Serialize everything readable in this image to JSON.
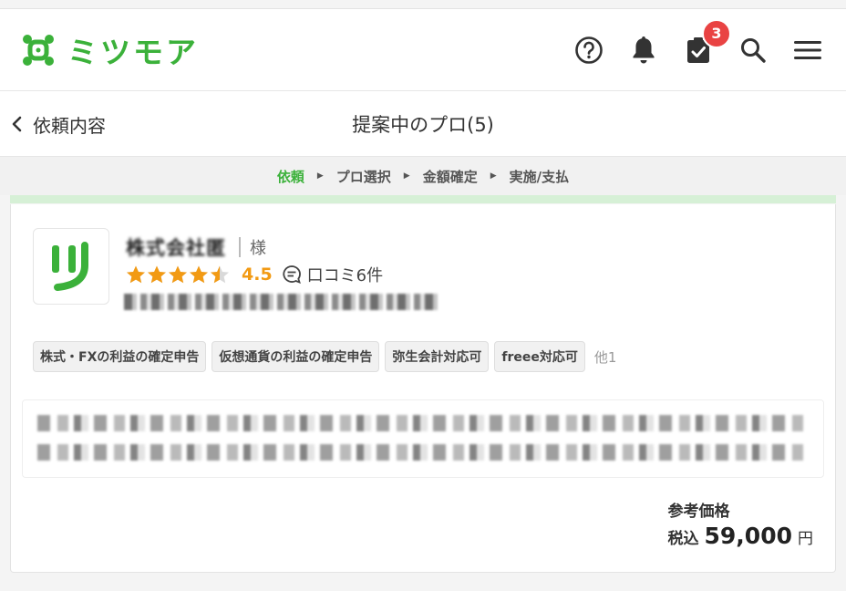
{
  "header": {
    "logo_text": "ミツモア",
    "icons": [
      "help-icon",
      "bell-icon",
      "task-check-icon",
      "search-icon",
      "menu-icon"
    ],
    "task_badge": "3",
    "colors": {
      "brand": "#3bb13a",
      "badge": "#e94343"
    }
  },
  "titlebar": {
    "back_label": "依頼内容",
    "title": "提案中のプロ(5)"
  },
  "steps": [
    {
      "label": "依頼",
      "active": true
    },
    {
      "label": "プロ選択",
      "active": false
    },
    {
      "label": "金額確定",
      "active": false
    },
    {
      "label": "実施/支払",
      "active": false
    }
  ],
  "pro": {
    "name": "株式会社匿",
    "honorific": "様",
    "rating": "4.5",
    "rating_value": 4.5,
    "reviews": "口コミ6件",
    "tags": [
      "株式・FXの利益の確定申告",
      "仮想通貨の利益の確定申告",
      "弥生会計対応可",
      "freee対応可"
    ],
    "tags_more": "他1"
  },
  "price": {
    "label": "参考価格",
    "tax_label": "税込",
    "value": "59,000",
    "currency": "円"
  }
}
